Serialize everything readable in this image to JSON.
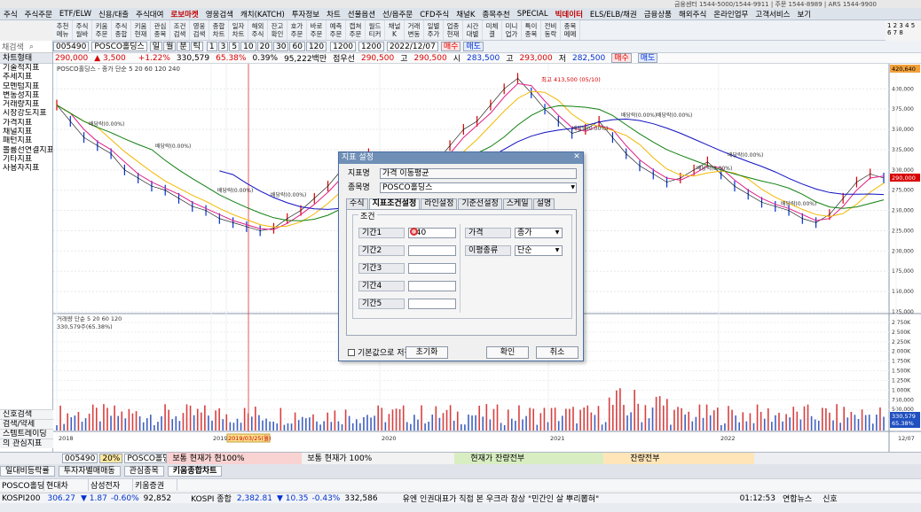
{
  "top_strip": "금융센터 1544-5000/1544-9911  |  주문 1544-8989  |  ARS 1544-9900",
  "menu": {
    "items": [
      "주식",
      "주식주문",
      "ETF/ELW",
      "신용/대출",
      "주식대여",
      "로보마켓",
      "영웅검색",
      "캐치(KATCH)",
      "투자정보",
      "차트",
      "선물옵션",
      "선/옵주문",
      "CFD주식",
      "채널K",
      "종목추천",
      "SPECIAL",
      "빅데이터",
      "ELS/ELB/채권",
      "금융상품",
      "해외주식",
      "온라인업무",
      "고객서비스",
      "보기"
    ],
    "highlight": [
      "로보마켓",
      "빅데이터"
    ]
  },
  "toolbar": {
    "items": [
      "추천 메뉴",
      "주식 월바",
      "키움 주문",
      "주식 종합",
      "키움 현재",
      "관심 종목",
      "조건 검색",
      "영웅 검색",
      "종합 차트",
      "일자 차트",
      "해외 주식",
      "잔고 확인",
      "호가 주문",
      "바로 주문",
      "예측 주문",
      "캡쳐 주문",
      "월드 티커",
      "채널 K",
      "거래 변동",
      "일별 주가",
      "업종 현재",
      "시간 대별",
      "미체 결",
      "미니 업가",
      "특이 종목",
      "전비 동락",
      "종목 메메"
    ]
  },
  "window_controls": "1 2 3 4 5 6 7 8",
  "sidebar": {
    "search_placeholder": "채검색",
    "header": "차트형태",
    "items": [
      "기술적지표",
      "추세지표",
      "모멘텀지표",
      "변동성지표",
      "거래량지표",
      "시장강도지표",
      "가격지표",
      "채널지표",
      "패턴지표",
      "볼륨선연결지표",
      "기타지표",
      "사용자지표"
    ],
    "bottom": [
      "신호검색",
      "검색/약세",
      "스템트레이딩",
      "의 관심지표"
    ]
  },
  "controls": {
    "code": "005490",
    "name": "POSCO홀딩스",
    "periods": [
      "일",
      "월",
      "분",
      "틱"
    ],
    "minutes": [
      "1",
      "3",
      "5",
      "10",
      "20",
      "30",
      "60",
      "120"
    ],
    "range": "1200",
    "range_max": "1200",
    "date": "2022/12/07",
    "buy": "매수",
    "sell": "매도"
  },
  "quote": {
    "price": "290,000",
    "change": "3,500",
    "change_pct": "+1.22%",
    "volume": "330,579",
    "volume_ratio": "65.38%",
    "turnover": "0.39%",
    "amount": "95,222백만",
    "open_label": "점우선",
    "open": "290,500",
    "high_label": "고",
    "high": "290,500",
    "low_label": "시",
    "low": "283,500",
    "close_label": "고",
    "close2": "293,000",
    "low2_label": "저",
    "low2": "282,500"
  },
  "chart_data": {
    "type": "line",
    "title": "POSCO홀딩스 - 종가 단순 5 20 60 120 240",
    "legend": [
      "종가 단순",
      "5",
      "20",
      "60",
      "120",
      "240"
    ],
    "x_ticks": [
      "2018",
      "2019",
      "2019/03/25(월)",
      "2020",
      "2021",
      "2022",
      "12/07"
    ],
    "y_ticks": [
      "400,000",
      "375,000",
      "350,000",
      "325,000",
      "300,000",
      "275,000",
      "250,000",
      "225,000",
      "200,000",
      "175,000",
      "150,000",
      "125,000"
    ],
    "price_label": "420,640",
    "current_price_label": "290,000",
    "high_annotation": "최고 413,500 (05/10)",
    "dividend_labels": [
      "배당락(0.00%)"
    ],
    "volume_legend": "거래량 단순 5 20 60 120",
    "volume_value": "330,579주(65.38%)",
    "volume_ticks": [
      "2,750K",
      "2,500K",
      "2,250K",
      "2,000K",
      "1,750K",
      "1,500K",
      "1,250K",
      "1,000K",
      "750,000",
      "500,000",
      "250,000"
    ],
    "volume_last_labels": [
      "330,579",
      "65.38%"
    ],
    "series": [
      {
        "name": "종가",
        "color": "#000000",
        "values": [
          380,
          360,
          340,
          330,
          320,
          300,
          290,
          280,
          275,
          265,
          255,
          250,
          240,
          235,
          230,
          225,
          228,
          240,
          250,
          265,
          280,
          300,
          310,
          320,
          315,
          305,
          295,
          300,
          310,
          330,
          350,
          360,
          380,
          400,
          413,
          395,
          375,
          360,
          345,
          350,
          360,
          340,
          320,
          305,
          295,
          285,
          290,
          300,
          310,
          295,
          280,
          270,
          260,
          255,
          250,
          240,
          235,
          245,
          265,
          285,
          295,
          290
        ]
      },
      {
        "name": "5",
        "color": "#e0208a"
      },
      {
        "name": "20",
        "color": "#f2b800"
      },
      {
        "name": "60",
        "color": "#108010"
      },
      {
        "name": "120",
        "color": "#1010c0"
      }
    ],
    "ylim": [
      125000,
      420000
    ]
  },
  "dialog": {
    "title": "지표 설정",
    "name_label": "지표명",
    "name_value": "가격 이동평균",
    "stock_label": "종목명",
    "stock_value": "POSCO홀딩스",
    "tabs": [
      "수식",
      "지표조건설정",
      "라인설정",
      "기준선설정",
      "스케일",
      "설명"
    ],
    "active_tab": "지표조건설정",
    "group_label": "조건",
    "periods": [
      {
        "label": "기간1",
        "value": "440"
      },
      {
        "label": "기간2",
        "value": ""
      },
      {
        "label": "기간3",
        "value": ""
      },
      {
        "label": "기간4",
        "value": ""
      },
      {
        "label": "기간5",
        "value": ""
      }
    ],
    "price_label": "가격",
    "price_value": "종가",
    "ma_type_label": "이평종류",
    "ma_type_value": "단순",
    "save_default": "기본값으로 저장",
    "reset": "초기화",
    "ok": "확인",
    "cancel": "취소"
  },
  "bottom1": {
    "code": "005490",
    "pct": "20%",
    "name": "POSCO홀딩",
    "segs": [
      "보통  현재가  현100%",
      "보통  현재가  100%",
      "현재가  잔량전부",
      "잔량전부"
    ]
  },
  "bottom2": {
    "tabs": [
      "일대비등락률",
      "투자자별매매동",
      "관심종목",
      "키움종합차트"
    ]
  },
  "bottom3": {
    "items": [
      "POSCO홀딩스",
      "현대차",
      "삼성전자",
      "키움증권"
    ]
  },
  "bottom4": {
    "kospi200_label": "KOSPI200",
    "kospi200": "306.27",
    "kospi200_chg": "1.87",
    "kospi200_pct": "-0.60%",
    "kospi200_vol": "92,852",
    "kospi_label": "KOSPI 종합",
    "kospi": "2,382.81",
    "kospi_chg": "10.35",
    "kospi_pct": "-0.43%",
    "kospi_vol": "332,586",
    "news": "유엔 인권대표가 직접 본 우크라 참상 \"민간인 살 뿌리뽑혀\"",
    "time": "01:12:53",
    "news_src": "연합뉴스",
    "tail": "신호"
  }
}
